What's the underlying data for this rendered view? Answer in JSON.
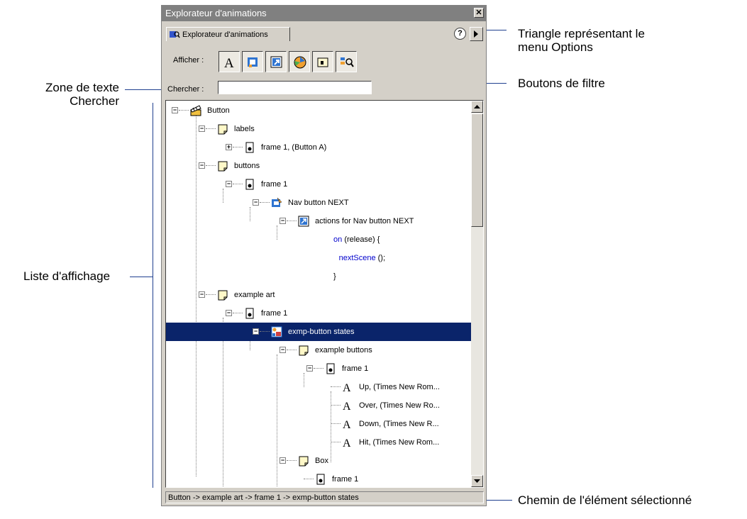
{
  "window": {
    "title": "Explorateur d'animations",
    "close_glyph": "✕"
  },
  "tab": {
    "label": "Explorateur d'animations"
  },
  "help_glyph": "?",
  "filters": {
    "label": "Afficher :",
    "buttons": [
      "text-filter-icon",
      "button-symbol-filter-icon",
      "actions-filter-icon",
      "video-sound-bitmap-filter-icon",
      "frames-layers-filter-icon",
      "customize-filter-icon"
    ]
  },
  "search": {
    "label": "Chercher :",
    "value": ""
  },
  "tree": [
    {
      "label": "Button",
      "icon": "scene-icon"
    },
    {
      "label": "labels",
      "icon": "layer-icon"
    },
    {
      "label": "frame 1, (Button A)",
      "icon": "frame-icon"
    },
    {
      "label": "buttons",
      "icon": "layer-icon"
    },
    {
      "label": "frame 1",
      "icon": "frame-icon"
    },
    {
      "label": "Nav button NEXT",
      "icon": "button-symbol-icon"
    },
    {
      "label": "actions for Nav button NEXT",
      "icon": "action-icon"
    },
    {
      "code_kw": "on",
      "code_rest": "(release) {"
    },
    {
      "code_kw": "nextScene",
      "code_rest": "();"
    },
    {
      "label": "}"
    },
    {
      "label": "example art",
      "icon": "layer-icon"
    },
    {
      "label": "frame 1",
      "icon": "frame-icon"
    },
    {
      "label": "exmp-button states",
      "icon": "movieclip-icon",
      "selected": true
    },
    {
      "label": "example buttons",
      "icon": "layer-icon"
    },
    {
      "label": "frame 1",
      "icon": "frame-icon"
    },
    {
      "label": "Up, (Times New Rom...",
      "icon": "text-icon"
    },
    {
      "label": "Over, (Times New Ro...",
      "icon": "text-icon"
    },
    {
      "label": "Down, (Times New R...",
      "icon": "text-icon"
    },
    {
      "label": "Hit, (Times New Rom...",
      "icon": "text-icon"
    },
    {
      "label": "Box",
      "icon": "layer-icon"
    },
    {
      "label": "frame 1",
      "icon": "frame-icon"
    }
  ],
  "status_path": "Button -> example art -> frame 1 -> exmp-button states",
  "callouts": {
    "options_menu": "Triangle représentant le\nmenu Options",
    "filter_buttons": "Boutons de filtre",
    "search_box": "Zone de texte\nChercher",
    "display_list": "Liste d'affichage",
    "selected_path": "Chemin de l'élément sélectionné"
  }
}
